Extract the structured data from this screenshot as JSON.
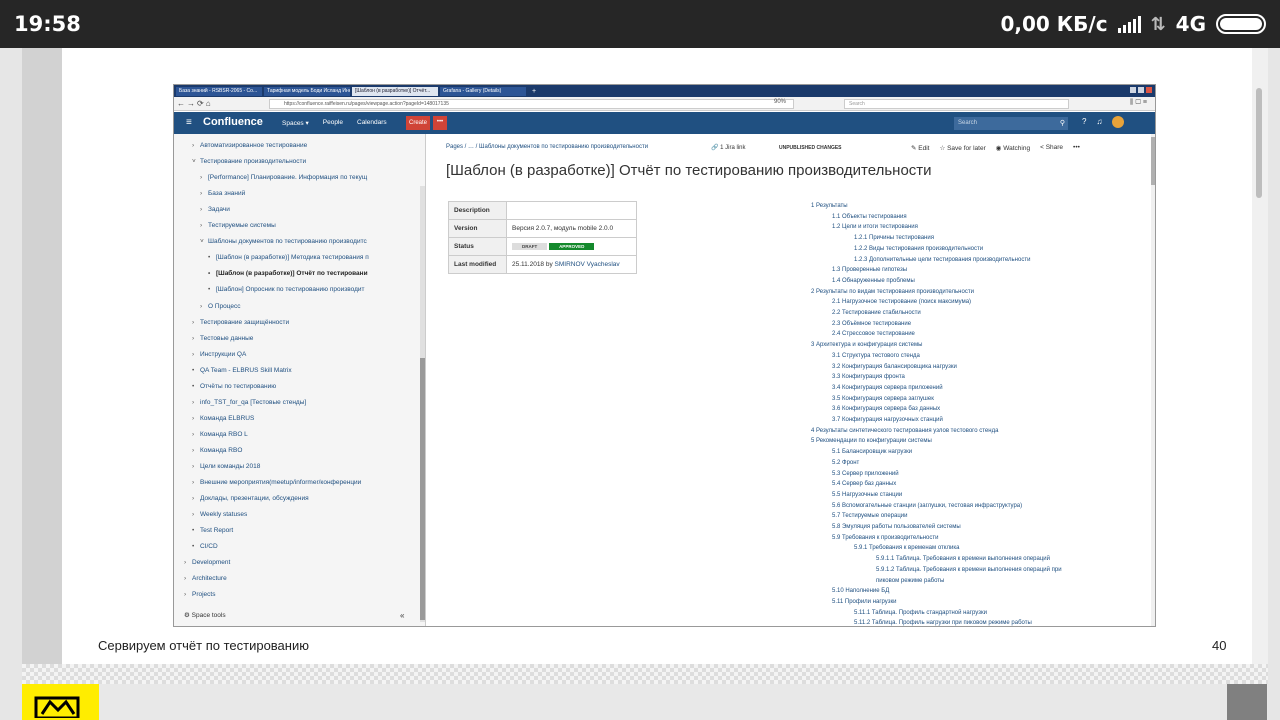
{
  "statusbar": {
    "time": "19:58",
    "speed": "0,00 КБ/с",
    "network": "4G"
  },
  "slide": {
    "caption": "Сервируем отчёт по тестированию",
    "page_number": "40"
  },
  "browser": {
    "tabs": [
      {
        "label": "База знаний - RSBSR-2065 - Co...",
        "active": false
      },
      {
        "label": "Тарифная модель Боди Исланд Инн...",
        "active": false
      },
      {
        "label": "[Шаблон (в разработке)] Отчёт...",
        "active": true
      },
      {
        "label": "Grafana - Gallery (Details)",
        "active": false
      }
    ],
    "url": "https://confluence.raiffeisen.ru/pages/viewpage.action?pageId=148017135",
    "zoom": "90%",
    "search_placeholder": "Search"
  },
  "confluence": {
    "logo": "Confluence",
    "nav": [
      "Spaces ▾",
      "People",
      "Calendars"
    ],
    "create": "Create",
    "more": "•••",
    "search_placeholder": "Search"
  },
  "sidebar": {
    "items": [
      {
        "mark": "›",
        "label": "Автоматизированное тестирование"
      },
      {
        "mark": "˅",
        "label": "Тестирование производительности"
      },
      {
        "mark": "›",
        "label": "[Performance] Планирование. Информация по текущ"
      },
      {
        "mark": "›",
        "label": "База знаний"
      },
      {
        "mark": "›",
        "label": "Задачи"
      },
      {
        "mark": "›",
        "label": "Тестируемые системы"
      },
      {
        "mark": "˅",
        "label": "Шаблоны документов по тестированию производитс"
      },
      {
        "mark": "•",
        "label": "[Шаблон (в разработке)] Методика тестирования п"
      },
      {
        "mark": "•",
        "label": "[Шаблон (в разработке)] Отчёт по тестировани"
      },
      {
        "mark": "•",
        "label": "[Шаблон] Опросник по тестированию производит"
      },
      {
        "mark": "›",
        "label": "О Процесс"
      },
      {
        "mark": "›",
        "label": "Тестирование защищённости"
      },
      {
        "mark": "›",
        "label": "Тестовые данные"
      },
      {
        "mark": "›",
        "label": "Инструкции QA"
      },
      {
        "mark": "•",
        "label": "QA Team - ELBRUS Skill Matrix"
      },
      {
        "mark": "•",
        "label": "Отчёты по тестированию"
      },
      {
        "mark": "›",
        "label": "info_TST_for_qa [Тестовые стенды]"
      },
      {
        "mark": "›",
        "label": "Команда ELBRUS"
      },
      {
        "mark": "›",
        "label": "Команда RBO L"
      },
      {
        "mark": "›",
        "label": "Команда RBO"
      },
      {
        "mark": "›",
        "label": "Цели команды 2018"
      },
      {
        "mark": "›",
        "label": "Внешние мероприятия(meetup/informer/конференции"
      },
      {
        "mark": "›",
        "label": "Доклады, презентации, обсуждения"
      },
      {
        "mark": "›",
        "label": "Weekly statuses"
      },
      {
        "mark": "•",
        "label": "Test Report"
      },
      {
        "mark": "•",
        "label": "CI/CD"
      },
      {
        "mark": "›",
        "label": "Development"
      },
      {
        "mark": "›",
        "label": "Architecture"
      },
      {
        "mark": "›",
        "label": "Projects"
      }
    ],
    "space_tools": "Space tools",
    "collapse": "«"
  },
  "page": {
    "breadcrumb": "Pages / … / Шаблоны документов по тестированию производительности",
    "jira": "1 Jira link",
    "unpublished": "UNPUBLISHED CHANGES",
    "actions": [
      "✎ Edit",
      "☆ Save for later",
      "◉ Watching",
      "< Share",
      "•••"
    ],
    "title": "[Шаблон (в разработке)] Отчёт по тестированию производительности",
    "meta": {
      "description_label": "Description",
      "description_value": "",
      "version_label": "Version",
      "version_value": "Версия 2.0.7, модуль mobile 2.0.0",
      "status_label": "Status",
      "status_draft": "DRAFT",
      "status_approved": "APPROVED",
      "modified_label": "Last modified",
      "modified_date": "25.11.2018 by ",
      "modified_user": "SMIRNOV Vyacheslav"
    },
    "toc": [
      {
        "level": 0,
        "text": "1 Результаты"
      },
      {
        "level": 1,
        "text": "1.1 Объекты тестирования"
      },
      {
        "level": 1,
        "text": "1.2 Цели и итоги тестирования"
      },
      {
        "level": 2,
        "text": "1.2.1 Причины тестирования"
      },
      {
        "level": 2,
        "text": "1.2.2 Виды тестирования производительности"
      },
      {
        "level": 2,
        "text": "1.2.3 Дополнительные цели тестирования производительности"
      },
      {
        "level": 1,
        "text": "1.3 Проверенные гипотезы"
      },
      {
        "level": 1,
        "text": "1.4 Обнаруженные проблемы"
      },
      {
        "level": 0,
        "text": "2 Результаты по видам тестирования производительности"
      },
      {
        "level": 1,
        "text": "2.1 Нагрузочное тестирование (поиск максимума)"
      },
      {
        "level": 1,
        "text": "2.2 Тестирование стабильности"
      },
      {
        "level": 1,
        "text": "2.3 Объёмное тестирование"
      },
      {
        "level": 1,
        "text": "2.4 Стрессовое тестирование"
      },
      {
        "level": 0,
        "text": "3 Архитектура и конфигурация системы"
      },
      {
        "level": 1,
        "text": "3.1 Структура тестового стенда"
      },
      {
        "level": 1,
        "text": "3.2 Конфигурация балансировщика нагрузки"
      },
      {
        "level": 1,
        "text": "3.3 Конфигурация фронта"
      },
      {
        "level": 1,
        "text": "3.4 Конфигурация сервера приложений"
      },
      {
        "level": 1,
        "text": "3.5 Конфигурация сервера заглушек"
      },
      {
        "level": 1,
        "text": "3.6 Конфигурация сервера баз данных"
      },
      {
        "level": 1,
        "text": "3.7 Конфигурация нагрузочных станций"
      },
      {
        "level": 0,
        "text": "4 Результаты синтетического тестирования узлов тестового стенда"
      },
      {
        "level": 0,
        "text": "5 Рекомендации по конфигурации системы"
      },
      {
        "level": 1,
        "text": "5.1 Балансировщик нагрузки"
      },
      {
        "level": 1,
        "text": "5.2 Фронт"
      },
      {
        "level": 1,
        "text": "5.3 Сервер приложений"
      },
      {
        "level": 1,
        "text": "5.4 Сервер баз данных"
      },
      {
        "level": 1,
        "text": "5.5 Нагрузочные станции"
      },
      {
        "level": 1,
        "text": "5.6 Вспомогательные станции (заглушки, тестовая инфраструктура)"
      },
      {
        "level": 1,
        "text": "5.7 Тестируемые операции"
      },
      {
        "level": 1,
        "text": "5.8 Эмуляция работы пользователей системы"
      },
      {
        "level": 1,
        "text": "5.9 Требования к производительности"
      },
      {
        "level": 2,
        "text": "5.9.1 Требования к временам отклика"
      },
      {
        "level": 3,
        "text": "5.9.1.1 Таблица. Требования к времени выполнения операций"
      },
      {
        "level": 3,
        "text": "5.9.1.2 Таблица. Требования к времени выполнения операций при"
      },
      {
        "level": 3,
        "text": "пиковом режиме работы"
      },
      {
        "level": 1,
        "text": "5.10 Наполнение БД"
      },
      {
        "level": 1,
        "text": "5.11 Профили нагрузки"
      },
      {
        "level": 2,
        "text": "5.11.1 Таблица. Профиль стандартной нагрузки"
      },
      {
        "level": 2,
        "text": "5.11.2 Таблица. Профиль нагрузки при пиковом режиме работы"
      }
    ]
  }
}
